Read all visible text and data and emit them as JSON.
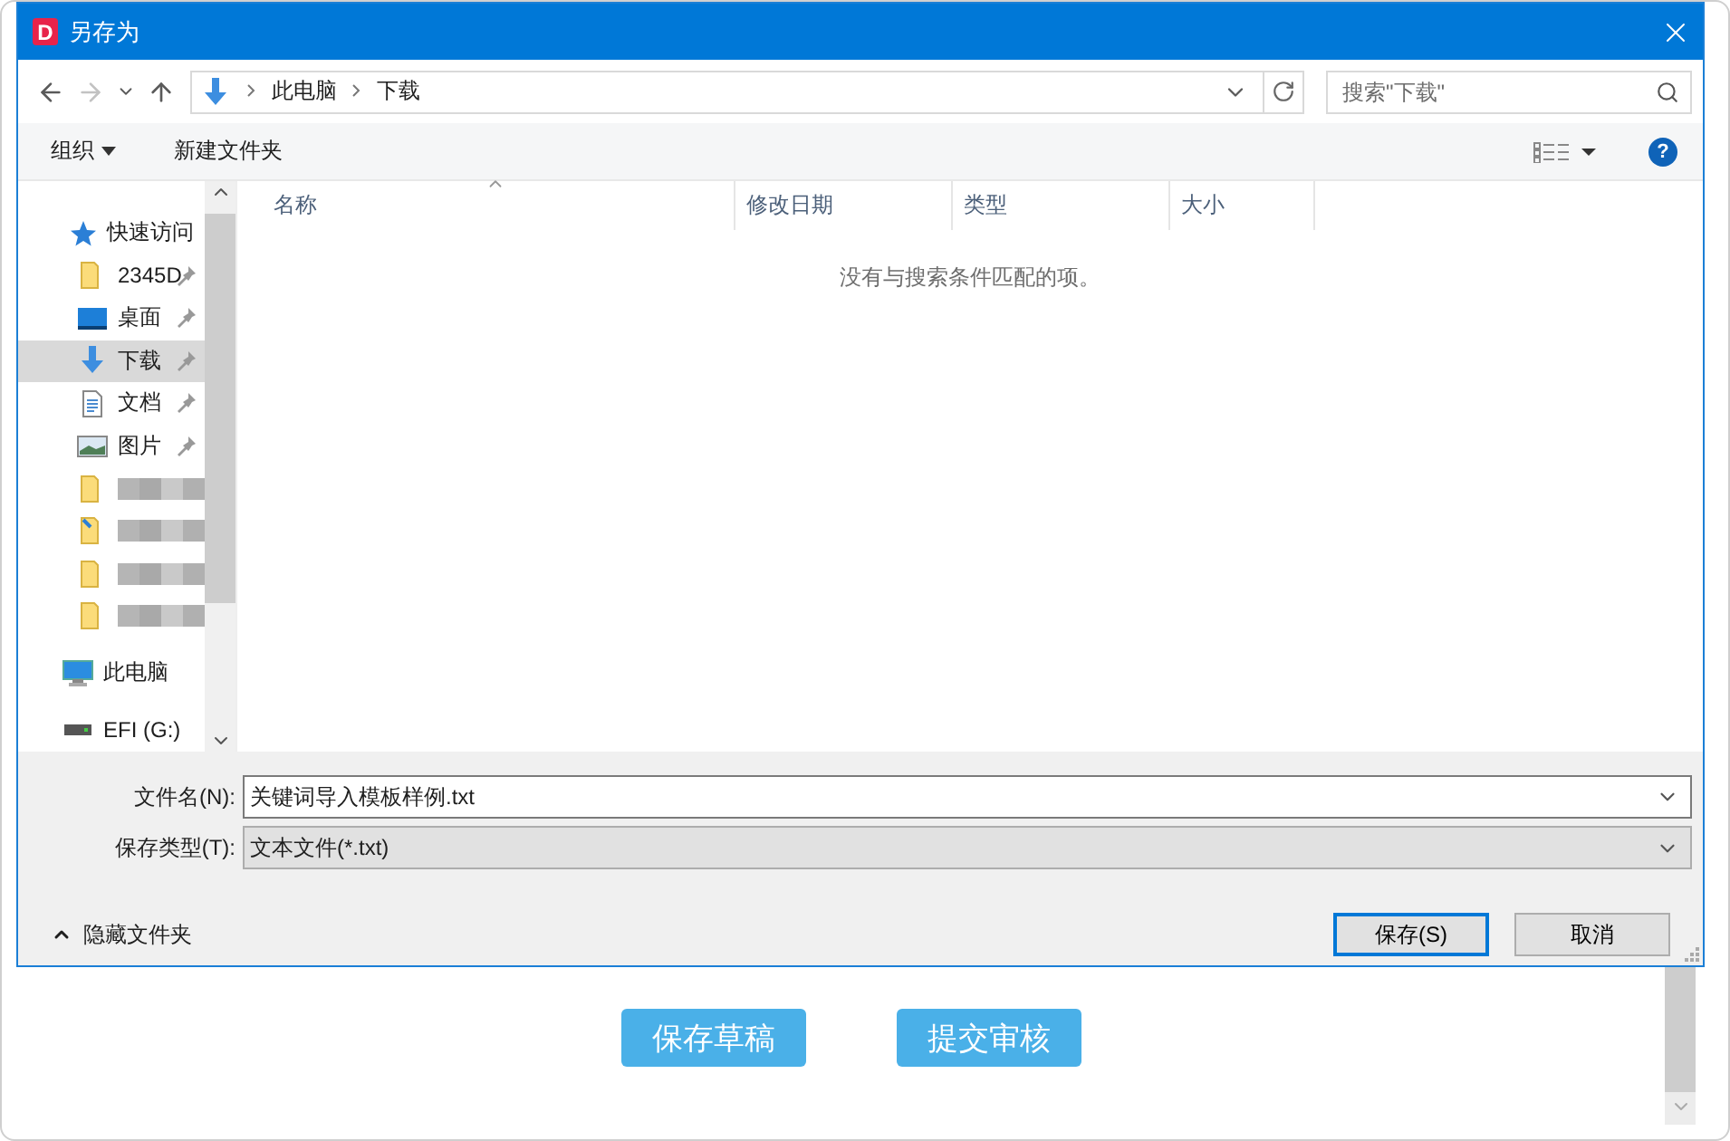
{
  "window": {
    "badge": "D",
    "title": "另存为"
  },
  "address": {
    "path": [
      "此电脑",
      "下载"
    ],
    "search_placeholder": "搜索\"下载\""
  },
  "toolbar": {
    "organize": "组织",
    "new_folder": "新建文件夹",
    "help": "?"
  },
  "sidebar": {
    "items": [
      {
        "label": "快速访问",
        "kind": "star",
        "selected": false,
        "children": [
          {
            "label": "2345D",
            "kind": "folder",
            "pinned": true,
            "selected": false
          },
          {
            "label": "桌面",
            "kind": "desktop",
            "pinned": true,
            "selected": false
          },
          {
            "label": "下载",
            "kind": "download",
            "pinned": true,
            "selected": true
          },
          {
            "label": "文档",
            "kind": "document",
            "pinned": true,
            "selected": false
          },
          {
            "label": "图片",
            "kind": "picture",
            "pinned": true,
            "selected": false
          },
          {
            "kind": "folder",
            "redacted": true,
            "selected": false
          },
          {
            "kind": "folder-link",
            "redacted": true,
            "selected": false
          },
          {
            "kind": "folder",
            "redacted": true,
            "selected": false
          },
          {
            "kind": "folder",
            "redacted": true,
            "selected": false
          }
        ]
      },
      {
        "label": "此电脑",
        "kind": "pc",
        "selected": false
      },
      {
        "label": "EFI (G:)",
        "kind": "drive",
        "selected": false
      }
    ]
  },
  "file_list": {
    "columns": [
      {
        "label": "名称",
        "sorted": true
      },
      {
        "label": "修改日期",
        "sorted": false
      },
      {
        "label": "类型",
        "sorted": false
      },
      {
        "label": "大小",
        "sorted": false
      }
    ],
    "empty_message": "没有与搜索条件匹配的项。"
  },
  "form": {
    "file_name": {
      "label": "文件名(N):",
      "value": "关键词导入模板样例.txt"
    },
    "file_type": {
      "label": "保存类型(T):",
      "value": "文本文件(*.txt)"
    }
  },
  "hide_folders": "隐藏文件夹",
  "dialog_buttons": [
    {
      "label": "保存(S)",
      "default": true
    },
    {
      "label": "取消",
      "default": false
    }
  ],
  "page_buttons": [
    "保存草稿",
    "提交审核"
  ]
}
